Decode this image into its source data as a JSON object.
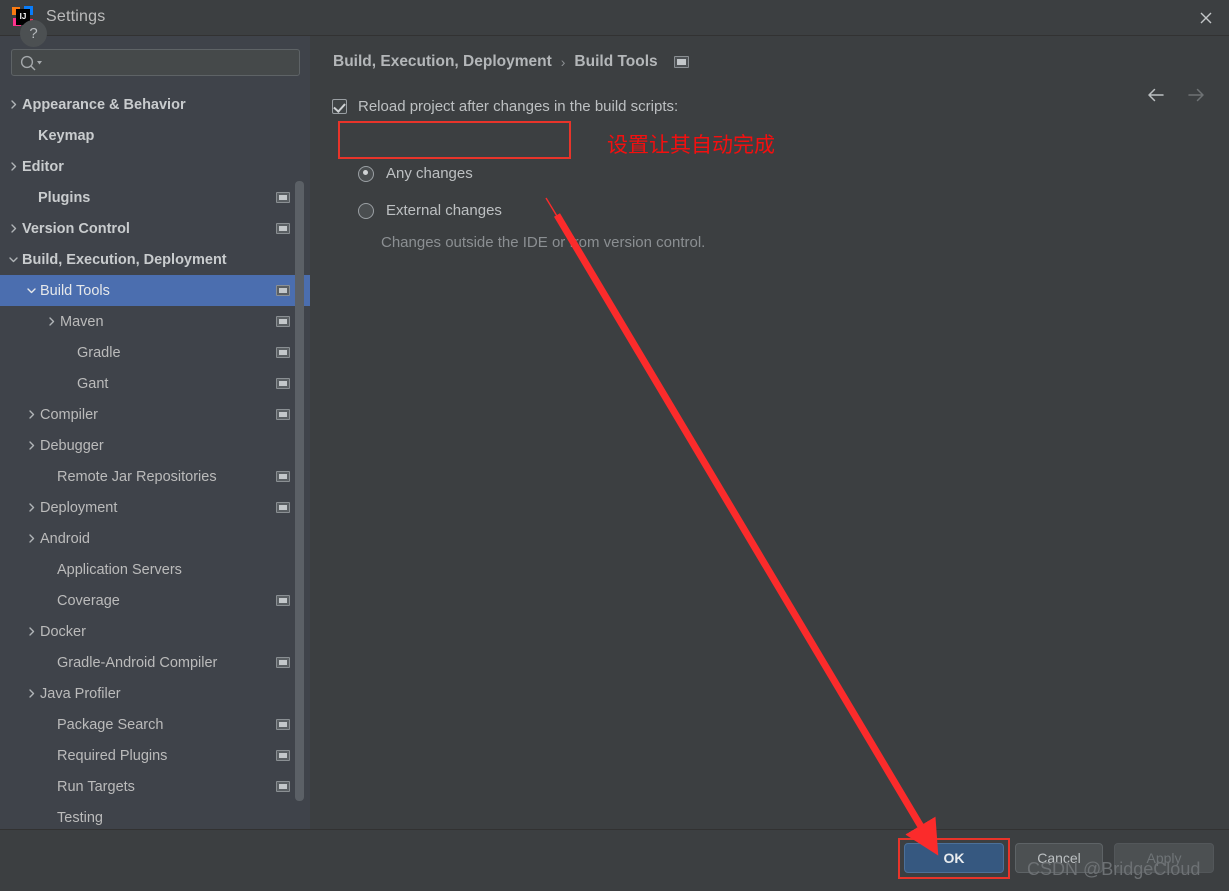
{
  "window": {
    "title": "Settings",
    "logo_icon": "intellij-idea-logo",
    "close_icon": "close-icon"
  },
  "search": {
    "placeholder": "",
    "value": "",
    "icon": "search-icon",
    "dropdown_icon": "chevron-down-icon"
  },
  "sidebar": {
    "items": [
      {
        "label": "Appearance & Behavior",
        "indent": 22,
        "arrow": "right",
        "bold": true,
        "badge": false,
        "selected": false
      },
      {
        "label": "Keymap",
        "indent": 38,
        "arrow": "none",
        "bold": true,
        "badge": false,
        "selected": false
      },
      {
        "label": "Editor",
        "indent": 22,
        "arrow": "right",
        "bold": true,
        "badge": false,
        "selected": false
      },
      {
        "label": "Plugins",
        "indent": 38,
        "arrow": "none",
        "bold": true,
        "badge": true,
        "selected": false
      },
      {
        "label": "Version Control",
        "indent": 22,
        "arrow": "right",
        "bold": true,
        "badge": true,
        "selected": false
      },
      {
        "label": "Build, Execution, Deployment",
        "indent": 22,
        "arrow": "down",
        "bold": true,
        "badge": false,
        "selected": false
      },
      {
        "label": "Build Tools",
        "indent": 40,
        "arrow": "down",
        "bold": false,
        "badge": true,
        "selected": true
      },
      {
        "label": "Maven",
        "indent": 60,
        "arrow": "right",
        "bold": false,
        "badge": true,
        "selected": false
      },
      {
        "label": "Gradle",
        "indent": 77,
        "arrow": "none",
        "bold": false,
        "badge": true,
        "selected": false
      },
      {
        "label": "Gant",
        "indent": 77,
        "arrow": "none",
        "bold": false,
        "badge": true,
        "selected": false
      },
      {
        "label": "Compiler",
        "indent": 40,
        "arrow": "right",
        "bold": false,
        "badge": true,
        "selected": false
      },
      {
        "label": "Debugger",
        "indent": 40,
        "arrow": "right",
        "bold": false,
        "badge": false,
        "selected": false
      },
      {
        "label": "Remote Jar Repositories",
        "indent": 57,
        "arrow": "none",
        "bold": false,
        "badge": true,
        "selected": false
      },
      {
        "label": "Deployment",
        "indent": 40,
        "arrow": "right",
        "bold": false,
        "badge": true,
        "selected": false
      },
      {
        "label": "Android",
        "indent": 40,
        "arrow": "right",
        "bold": false,
        "badge": false,
        "selected": false
      },
      {
        "label": "Application Servers",
        "indent": 57,
        "arrow": "none",
        "bold": false,
        "badge": false,
        "selected": false
      },
      {
        "label": "Coverage",
        "indent": 57,
        "arrow": "none",
        "bold": false,
        "badge": true,
        "selected": false
      },
      {
        "label": "Docker",
        "indent": 40,
        "arrow": "right",
        "bold": false,
        "badge": false,
        "selected": false
      },
      {
        "label": "Gradle-Android Compiler",
        "indent": 57,
        "arrow": "none",
        "bold": false,
        "badge": true,
        "selected": false
      },
      {
        "label": "Java Profiler",
        "indent": 40,
        "arrow": "right",
        "bold": false,
        "badge": false,
        "selected": false
      },
      {
        "label": "Package Search",
        "indent": 57,
        "arrow": "none",
        "bold": false,
        "badge": true,
        "selected": false
      },
      {
        "label": "Required Plugins",
        "indent": 57,
        "arrow": "none",
        "bold": false,
        "badge": true,
        "selected": false
      },
      {
        "label": "Run Targets",
        "indent": 57,
        "arrow": "none",
        "bold": false,
        "badge": true,
        "selected": false
      },
      {
        "label": "Testing",
        "indent": 57,
        "arrow": "none",
        "bold": false,
        "badge": false,
        "selected": false
      }
    ]
  },
  "breadcrumb": {
    "parent": "Build, Execution, Deployment",
    "separator": "›",
    "current": "Build Tools",
    "badge_icon": "project-scope-icon"
  },
  "nav": {
    "back_icon": "arrow-left-icon",
    "forward_icon": "arrow-right-icon"
  },
  "content": {
    "reload_checkbox_label": "Reload project after changes in the build scripts:",
    "reload_checked": true,
    "radio_any_label": "Any changes",
    "radio_any_selected": true,
    "radio_external_label": "External changes",
    "radio_external_selected": false,
    "external_hint": "Changes outside the IDE or from version control."
  },
  "annotations": {
    "chinese_note": "设置让其自动完成",
    "highlight_color": "#e8342a",
    "arrow_color": "#fb2b2b"
  },
  "footer": {
    "help_label": "?",
    "ok_label": "OK",
    "cancel_label": "Cancel",
    "apply_label": "Apply",
    "watermark": "CSDN @BridgeCloud"
  }
}
